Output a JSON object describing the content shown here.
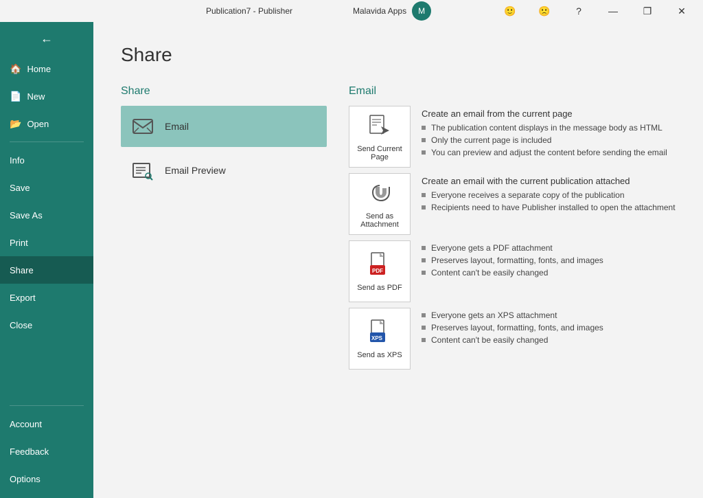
{
  "titlebar": {
    "app_title": "Publication7 - Publisher",
    "apps_label": "Malavida Apps",
    "minimize": "—",
    "restore": "❐",
    "close": "✕"
  },
  "sidebar": {
    "back_icon": "←",
    "home_label": "Home",
    "new_label": "New",
    "open_label": "Open",
    "info_label": "Info",
    "save_label": "Save",
    "save_as_label": "Save As",
    "print_label": "Print",
    "share_label": "Share",
    "export_label": "Export",
    "close_label": "Close",
    "account_label": "Account",
    "feedback_label": "Feedback",
    "options_label": "Options"
  },
  "page": {
    "title": "Share"
  },
  "share": {
    "section_title": "Share",
    "options": [
      {
        "label": "Email"
      },
      {
        "label": "Email Preview"
      }
    ]
  },
  "email": {
    "section_title": "Email",
    "options": [
      {
        "label": "Send Current Page",
        "title": "Create an email from the current page",
        "bullets": [
          "The publication content displays in the message body as HTML",
          "Only the current page is included",
          "You can preview and adjust the content before sending the email"
        ]
      },
      {
        "label": "Send as Attachment",
        "title": "Create an email with the current publication attached",
        "bullets": [
          "Everyone receives a separate copy of the publication",
          "Recipients need to have Publisher installed to open the attachment"
        ]
      },
      {
        "label": "Send as PDF",
        "title": "",
        "bullets": [
          "Everyone gets a PDF attachment",
          "Preserves layout, formatting, fonts, and images",
          "Content can't be easily changed"
        ]
      },
      {
        "label": "Send as XPS",
        "title": "",
        "bullets": [
          "Everyone gets an XPS attachment",
          "Preserves layout, formatting, fonts, and images",
          "Content can't be easily changed"
        ]
      }
    ]
  }
}
